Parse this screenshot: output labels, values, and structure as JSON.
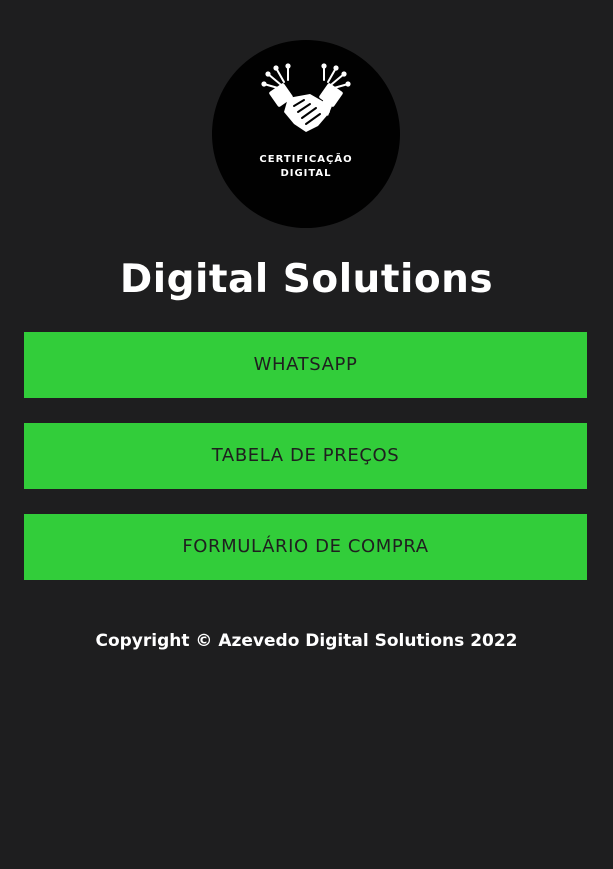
{
  "logo": {
    "icon": "handshake-circuit-icon",
    "line1": "CERTIFICAÇÃO",
    "line2": "DIGITAL",
    "background": "#010101"
  },
  "title": "Digital Solutions",
  "links": [
    {
      "label": "WHATSAPP"
    },
    {
      "label": "TABELA DE PREÇOS"
    },
    {
      "label": "FORMULÁRIO DE COMPRA"
    }
  ],
  "footer": {
    "copyright": "Copyright © Azevedo Digital Solutions 2022"
  },
  "colors": {
    "page_background": "#1e1e1f",
    "button_background": "#32cd3a",
    "button_text": "#1f1f1f",
    "text": "#ffffff"
  }
}
